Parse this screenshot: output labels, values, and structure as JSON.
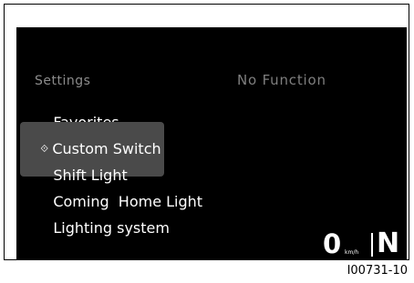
{
  "menu": {
    "header": "Settings",
    "items": [
      {
        "label": "Favorites",
        "selected": false
      },
      {
        "label": "Custom Switch",
        "selected": true
      },
      {
        "label": "Shift Light",
        "selected": false
      },
      {
        "label": "Coming  Home Light",
        "selected": false
      },
      {
        "label": "Lighting system",
        "selected": false
      }
    ]
  },
  "right_panel": {
    "info": "No Function"
  },
  "status": {
    "speed": "0",
    "speed_unit": "km/h",
    "gear": "N"
  },
  "figure": {
    "id": "I00731-10"
  },
  "colors": {
    "screen_bg": "#000000",
    "text": "#ffffff",
    "dim_text": "#8c8c8c",
    "selection_bg": "#4a4a4a"
  },
  "icons": {
    "selection_marker": "diamond-arrow-icon"
  }
}
